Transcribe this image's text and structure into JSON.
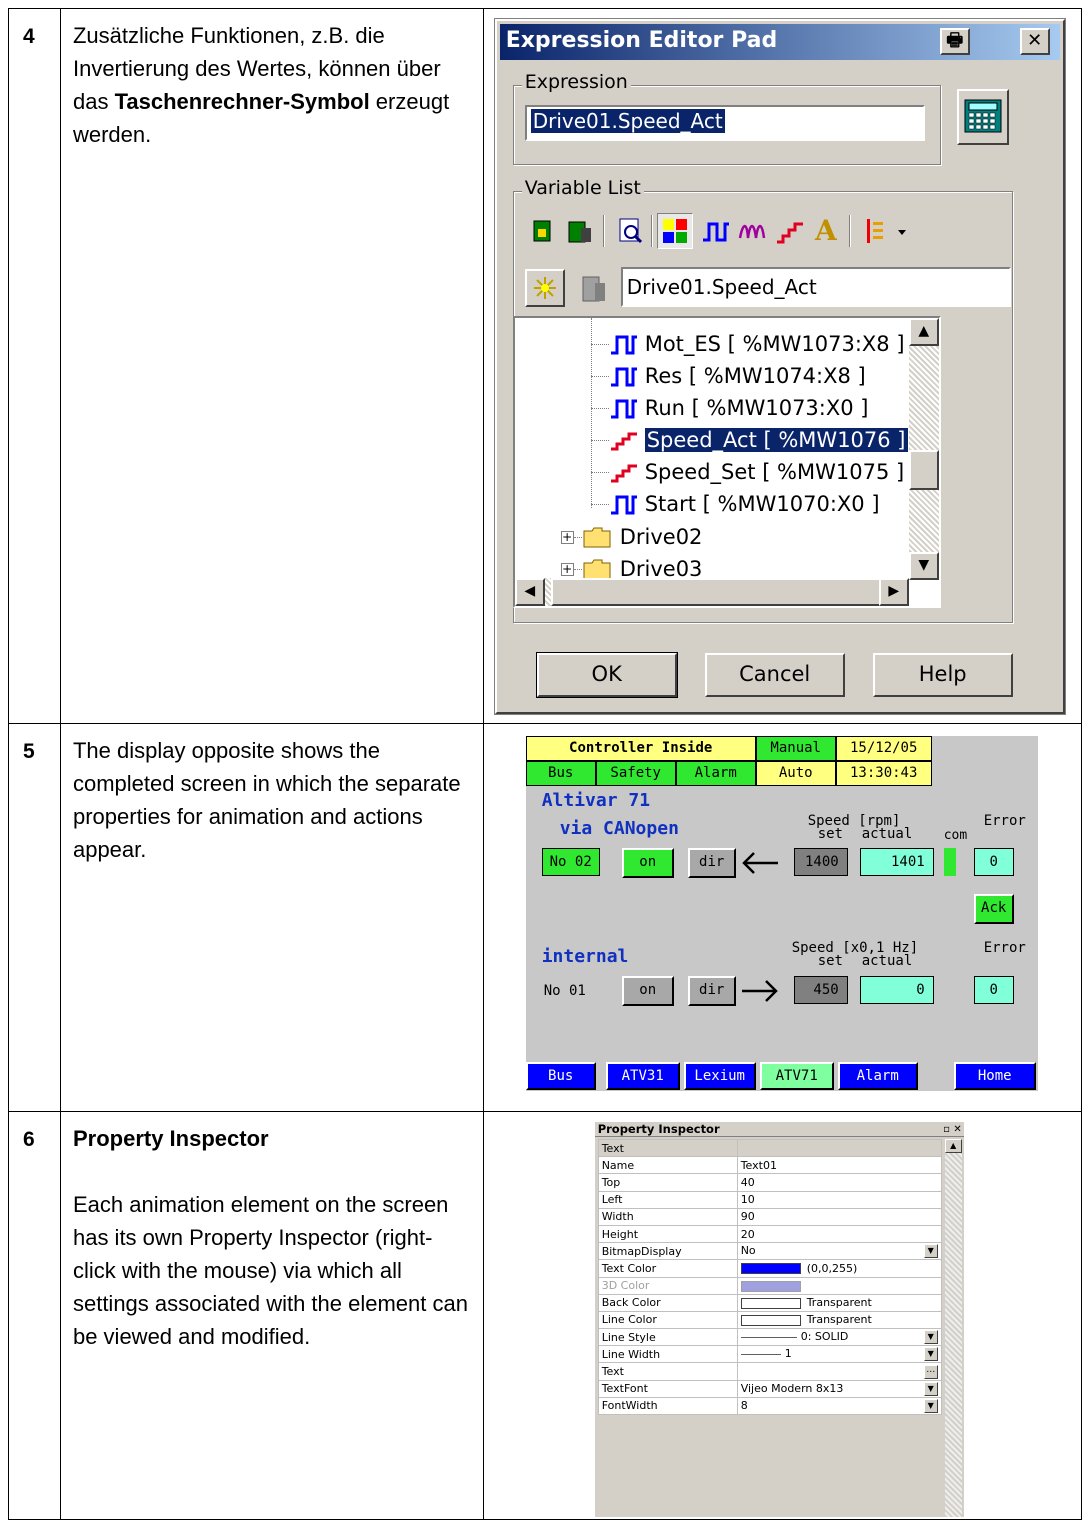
{
  "rows": [
    {
      "num": "4",
      "text_before": "Zusätzliche Funktionen, z.B. die Invertierung des Wertes, können über das ",
      "text_bold": "Taschenrechner-Symbol",
      "text_after": " erzeugt werden."
    },
    {
      "num": "5",
      "text": "The display opposite shows the completed screen in which the separate properties for animation and actions appear."
    },
    {
      "num": "6",
      "heading": "Property Inspector",
      "text": "Each animation element on the screen has its own Property Inspector (right-click with the mouse) via which all settings associated with the element can be viewed and modified."
    }
  ],
  "expression_editor": {
    "title": "Expression Editor Pad",
    "print_glyph": "🖶",
    "close_glyph": "✕",
    "expression_label": "Expression",
    "expression_value": "Drive01.Speed_Act",
    "variable_list_label": "Variable List",
    "selected_variable": "Drive01.Speed_Act",
    "tree": [
      {
        "label": "Mot_ES [ %MW1073:X8 ]",
        "icon": "bool-pulse-icon",
        "selected": false
      },
      {
        "label": "Res [ %MW1074:X8 ]",
        "icon": "bool-pulse-icon",
        "selected": false
      },
      {
        "label": "Run [ %MW1073:X0 ]",
        "icon": "bool-pulse-icon",
        "selected": false
      },
      {
        "label": "Speed_Act [ %MW1076 ]",
        "icon": "analog-ramp-icon",
        "selected": true
      },
      {
        "label": "Speed_Set [ %MW1075 ]",
        "icon": "analog-ramp-icon",
        "selected": false
      },
      {
        "label": "Start [ %MW1070:X0 ]",
        "icon": "bool-pulse-icon",
        "selected": false
      }
    ],
    "folders": [
      "Drive02",
      "Drive03"
    ],
    "buttons": {
      "ok": "OK",
      "cancel": "Cancel",
      "help": "Help"
    }
  },
  "hmi": {
    "title": "Controller Inside",
    "mode": "Manual",
    "date": "15/12/05",
    "status_tabs": [
      "Bus",
      "Safety",
      "Alarm"
    ],
    "auto": "Auto",
    "time": "13:30:43",
    "device": "Altivar 71",
    "section1": "via CANopen",
    "section2": "internal",
    "speed_hdr1": "Speed [rpm]",
    "speed_hdr2": "Speed [x0,1 Hz]",
    "set": "set",
    "actual": "actual",
    "com": "com",
    "error": "Error",
    "drive1": {
      "id": "No 02",
      "on": "on",
      "dir": "dir",
      "set": "1400",
      "actual": "1401",
      "error": "0"
    },
    "ack": "Ack",
    "drive2": {
      "id": "No 01",
      "on": "on",
      "dir": "dir",
      "set": "450",
      "actual": "0",
      "error": "0"
    },
    "nav": [
      "Bus",
      "ATV31",
      "Lexium",
      "ATV71",
      "Alarm",
      "Home"
    ]
  },
  "property_inspector": {
    "title": "Property Inspector",
    "category": "Text",
    "rows": [
      {
        "key": "Name",
        "value": "Text01"
      },
      {
        "key": "Top",
        "value": "40"
      },
      {
        "key": "Left",
        "value": "10"
      },
      {
        "key": "Width",
        "value": "90"
      },
      {
        "key": "Height",
        "value": "20"
      },
      {
        "key": "BitmapDisplay",
        "value": "No"
      },
      {
        "key": "Text Color",
        "value": "(0,0,255)"
      },
      {
        "key": "3D Color",
        "value": ""
      },
      {
        "key": "Back Color",
        "value": "Transparent"
      },
      {
        "key": "Line Color",
        "value": "Transparent"
      },
      {
        "key": "Line Style",
        "value": "0: SOLID"
      },
      {
        "key": "Line Width",
        "value": "1"
      },
      {
        "key": "Text",
        "value": ""
      },
      {
        "key": "TextFont",
        "value": "Vijeo Modern 8x13"
      },
      {
        "key": "FontWidth",
        "value": "8"
      }
    ]
  },
  "colors": {
    "title_blue": "#0a246a",
    "hmi_yellow": "#ffff80",
    "hmi_green": "#30e830",
    "hmi_cyan": "#80ffd8",
    "hmi_blue": "#0000ff"
  }
}
